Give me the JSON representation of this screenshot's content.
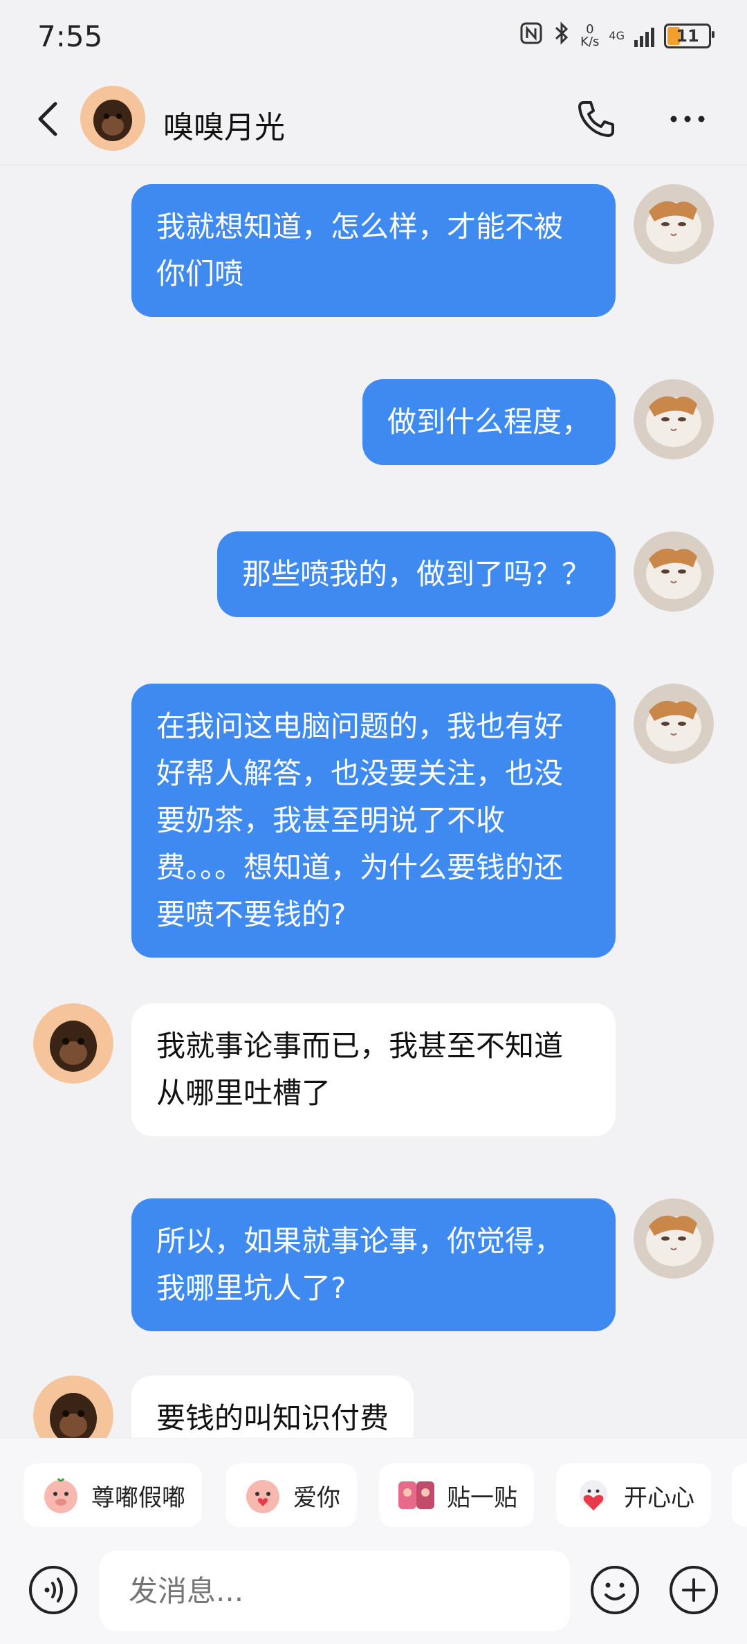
{
  "status_bar": {
    "time": "7:55",
    "speed_value": "0",
    "speed_unit": "K/s",
    "network": "4G",
    "battery": "11",
    "battery_color": "#f1a02b"
  },
  "header": {
    "title": "嗅嗅月光"
  },
  "messages": [
    {
      "side": "me",
      "text": "我就想知道，怎么样，才能不被你们喷"
    },
    {
      "side": "me",
      "text": "做到什么程度，"
    },
    {
      "side": "me",
      "text": "那些喷我的，做到了吗？？"
    },
    {
      "side": "me",
      "text": "在我问这电脑问题的，我也有好好帮人解答，也没要关注，也没要奶茶，我甚至明说了不收费。。。想知道，为什么要钱的还要喷不要钱的?"
    },
    {
      "side": "other",
      "text": "我就事论事而已，我甚至不知道从哪里吐槽了"
    },
    {
      "side": "me",
      "text": "所以，如果就事论事，你觉得，我哪里坑人了?"
    },
    {
      "side": "other",
      "text": "要钱的叫知识付费"
    }
  ],
  "quick_replies": [
    {
      "label": "尊嘟假嘟",
      "icon": "pig-face-icon"
    },
    {
      "label": "爱你",
      "icon": "pig-heart-icon"
    },
    {
      "label": "贴一贴",
      "icon": "cuddle-icon"
    },
    {
      "label": "开心心",
      "icon": "happy-heart-icon"
    }
  ],
  "input": {
    "placeholder": "发消息..."
  },
  "colors": {
    "my_bubble": "#3e8af0",
    "other_bubble": "#ffffff",
    "background": "#f2f2f4"
  }
}
